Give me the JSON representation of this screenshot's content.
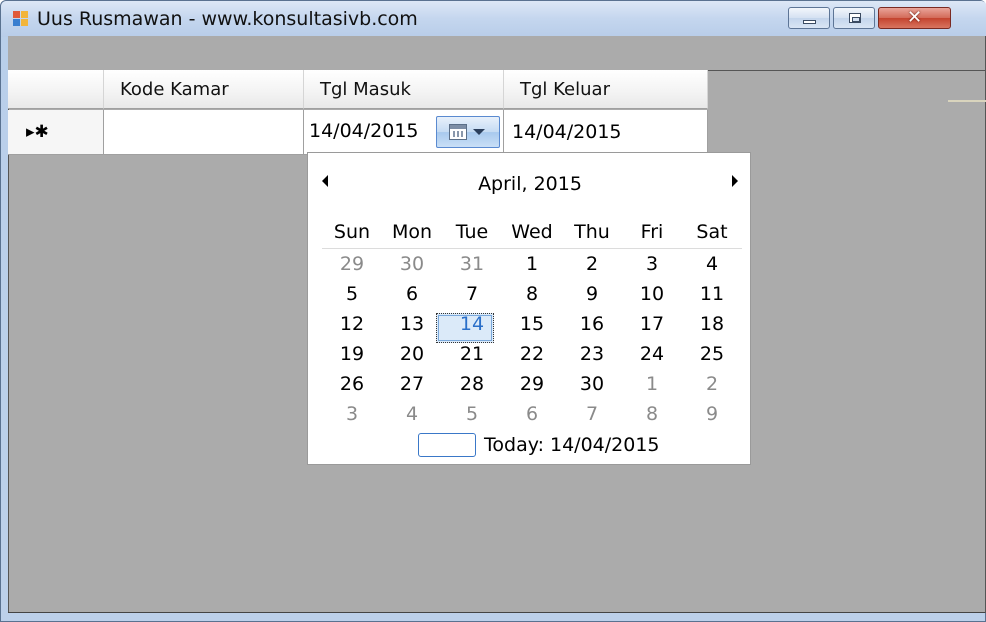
{
  "window": {
    "title": "Uus Rusmawan - www.konsultasivb.com",
    "close_glyph": "✕"
  },
  "grid": {
    "columns": [
      "Kode Kamar",
      "Tgl Masuk",
      "Tgl Keluar"
    ],
    "row_marker": "▸✱",
    "row": {
      "kode_kamar": "",
      "tgl_masuk": "14/04/2015",
      "tgl_keluar": "14/04/2015"
    }
  },
  "calendar": {
    "month_title": "April, 2015",
    "days_of_week": [
      "Sun",
      "Mon",
      "Tue",
      "Wed",
      "Thu",
      "Fri",
      "Sat"
    ],
    "weeks": [
      [
        "29",
        "30",
        "31",
        "1",
        "2",
        "3",
        "4"
      ],
      [
        "5",
        "6",
        "7",
        "8",
        "9",
        "10",
        "11"
      ],
      [
        "12",
        "13",
        "14",
        "15",
        "16",
        "17",
        "18"
      ],
      [
        "19",
        "20",
        "21",
        "22",
        "23",
        "24",
        "25"
      ],
      [
        "26",
        "27",
        "28",
        "29",
        "30",
        "1",
        "2"
      ],
      [
        "3",
        "4",
        "5",
        "6",
        "7",
        "8",
        "9"
      ]
    ],
    "selected_day": "14",
    "today_label": "Today: 14/04/2015"
  },
  "colors": {
    "accent": "#2a6fc9",
    "client_bg": "#ababab",
    "other_month": "#8a8a8a"
  }
}
